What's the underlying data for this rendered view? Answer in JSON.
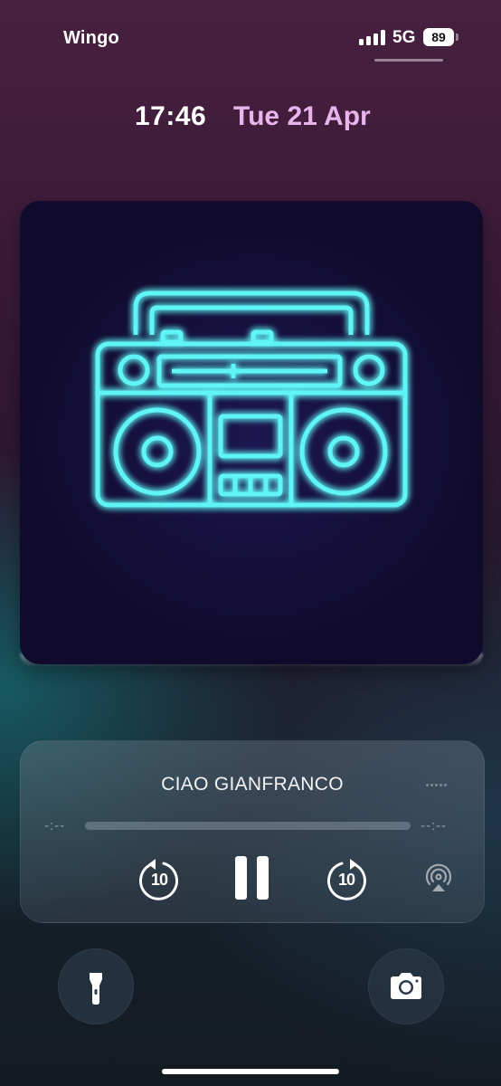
{
  "status_bar": {
    "carrier": "Wingo",
    "network": "5G",
    "battery_level": "89",
    "signal_bars": 4
  },
  "lock_screen": {
    "time": "17:46",
    "date": "Tue 21 Apr",
    "date_color": "#e7b4ec"
  },
  "artwork": {
    "subject": "neon-boombox-icon",
    "neon_color": "#32e8ee",
    "line_color": "#ff2e8c"
  },
  "player": {
    "title": "CIAO GIANFRANCO",
    "elapsed": "-:--",
    "remaining": "--:--",
    "progress_fraction": 0,
    "skip_back_label": "10",
    "skip_forward_label": "10",
    "icons": [
      "skip-back-10-icon",
      "pause-icon",
      "skip-forward-10-icon",
      "airplay-icon",
      "more-dots-icon"
    ]
  },
  "quick_actions": {
    "left_icon": "flashlight-icon",
    "right_icon": "camera-icon"
  }
}
